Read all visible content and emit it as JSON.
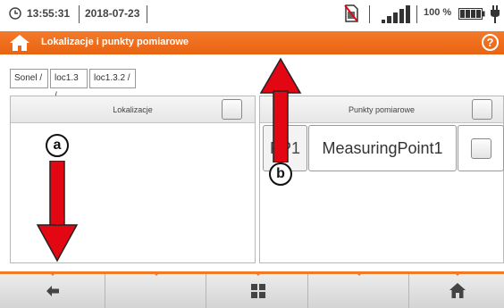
{
  "status": {
    "time": "13:55:31",
    "date": "2018-07-23",
    "battery_percent": "100 %"
  },
  "title": {
    "text": "Lokalizacje i punkty pomiarowe"
  },
  "breadcrumb": [
    "Sonel /",
    "loc1.3 /",
    "loc1.3.2 /"
  ],
  "left_panel": {
    "title": "Lokalizacje"
  },
  "right_panel": {
    "title": "Punkty pomiarowe",
    "items": [
      {
        "id": "PP1",
        "name": "MeasuringPoint1"
      }
    ]
  },
  "annotations": {
    "a": "a",
    "b": "b"
  },
  "colors": {
    "accent": "#f07a26",
    "arrow": "#e30613"
  },
  "icons": {
    "clock": "clock-icon",
    "sim": "sim-card-disabled-icon",
    "signal": "signal-strength-icon",
    "battery": "battery-icon",
    "plug": "power-plug-icon",
    "home": "home-icon",
    "help": "help-icon",
    "back": "arrow-left-icon",
    "grid": "grid-icon"
  }
}
